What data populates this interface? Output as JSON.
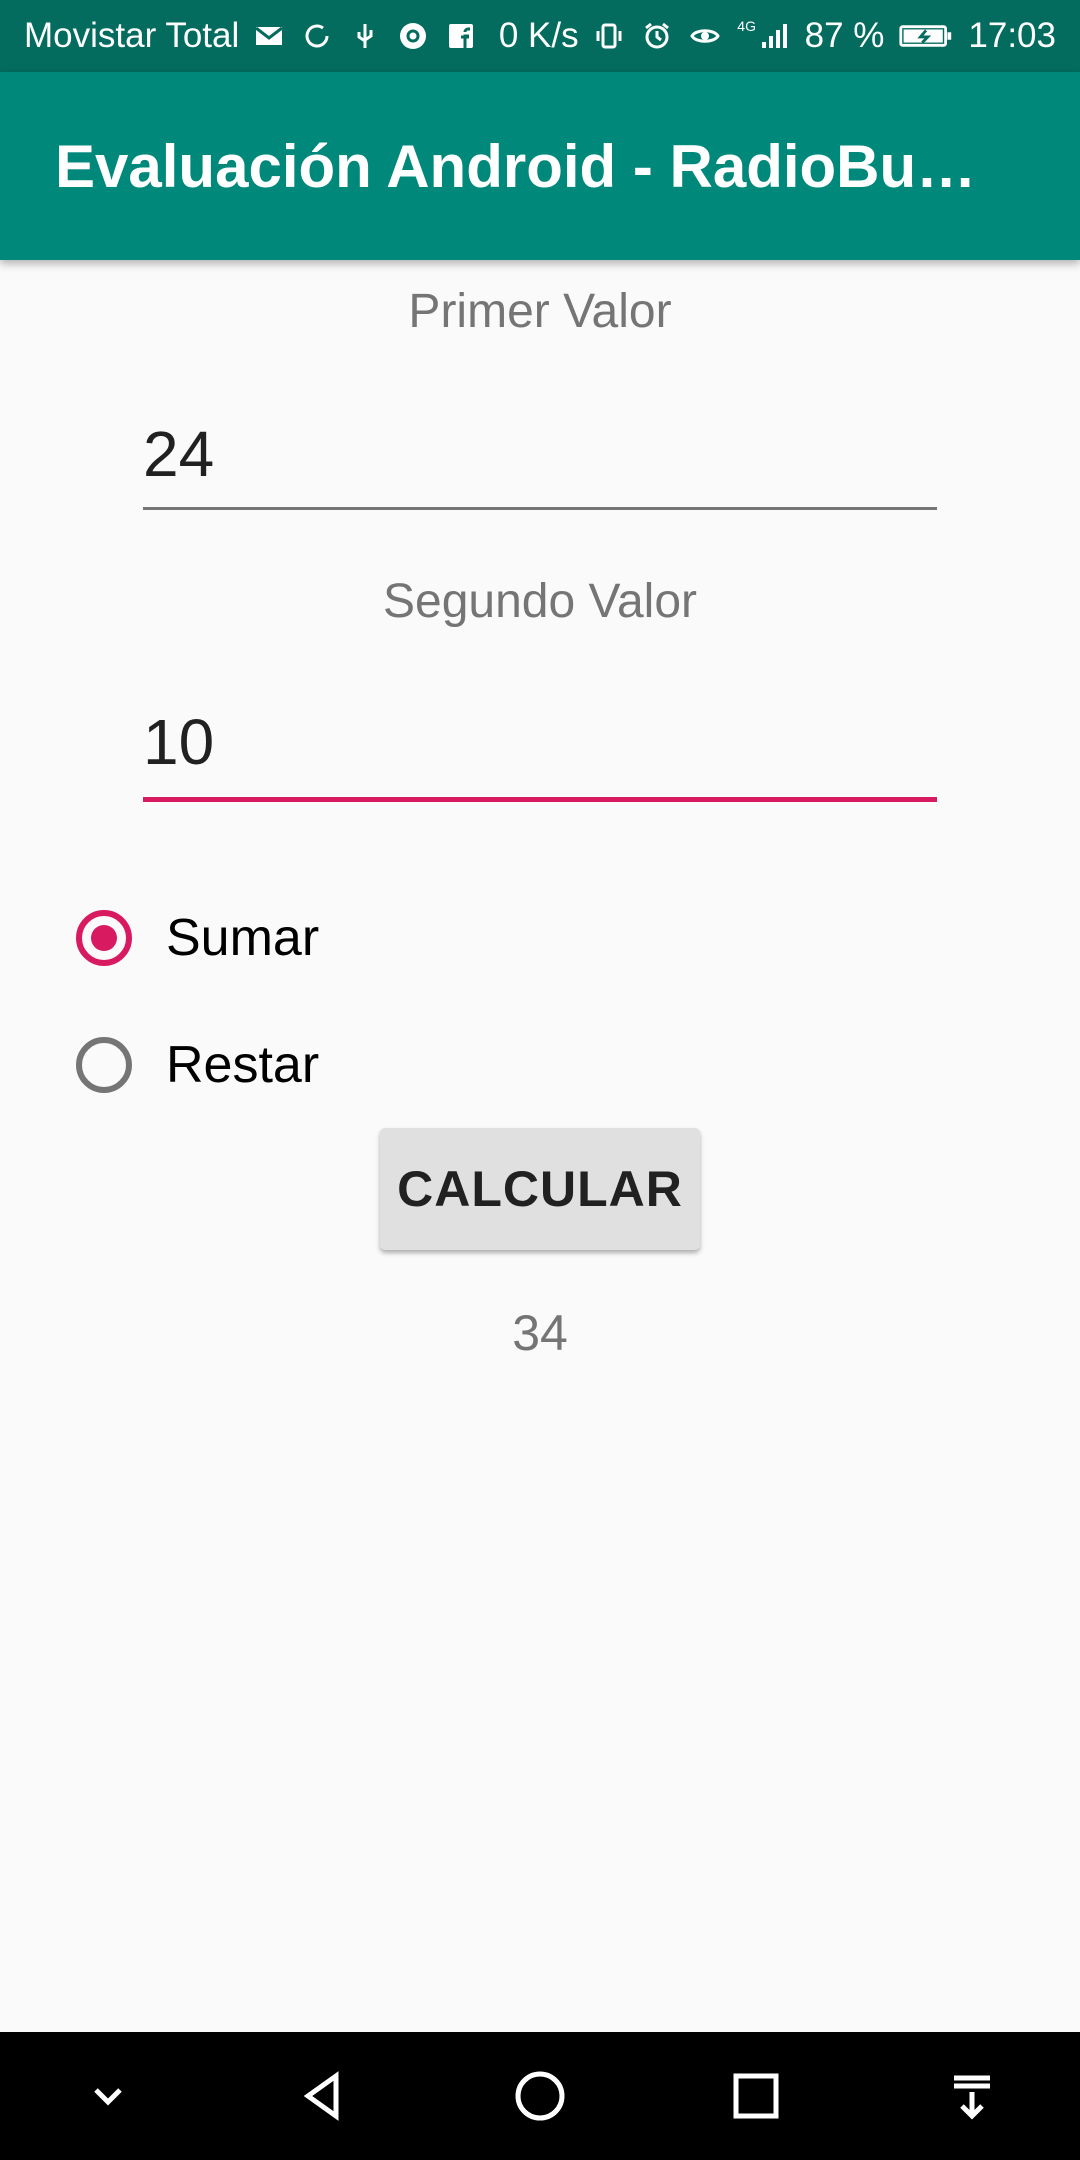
{
  "status_bar": {
    "carrier": "Movistar Total",
    "network_speed": "0 K/s",
    "network_type": "4G",
    "battery": "87 %",
    "time": "17:03",
    "icons": [
      "mail-icon",
      "sync-icon",
      "usb-icon",
      "chrome-icon",
      "facebook-icon",
      "vibrate-icon",
      "alarm-icon",
      "eye-icon",
      "signal-icon",
      "battery-charging-icon"
    ]
  },
  "toolbar": {
    "title": "Evaluación Android - RadioBu…"
  },
  "form": {
    "first_label": "Primer Valor",
    "first_value": "24",
    "second_label": "Segundo Valor",
    "second_value": "10",
    "radio_sumar": "Sumar",
    "radio_restar": "Restar",
    "selected_option": "Sumar",
    "button_label": "CALCULAR",
    "result": "34"
  },
  "nav_bar": {
    "icons": [
      "collapse-icon",
      "back-icon",
      "home-icon",
      "recents-icon",
      "notification-pull-icon"
    ]
  },
  "colors": {
    "status_bar": "#00695c",
    "toolbar": "#00897b",
    "accent": "#d81b60",
    "background": "#fafafa"
  }
}
